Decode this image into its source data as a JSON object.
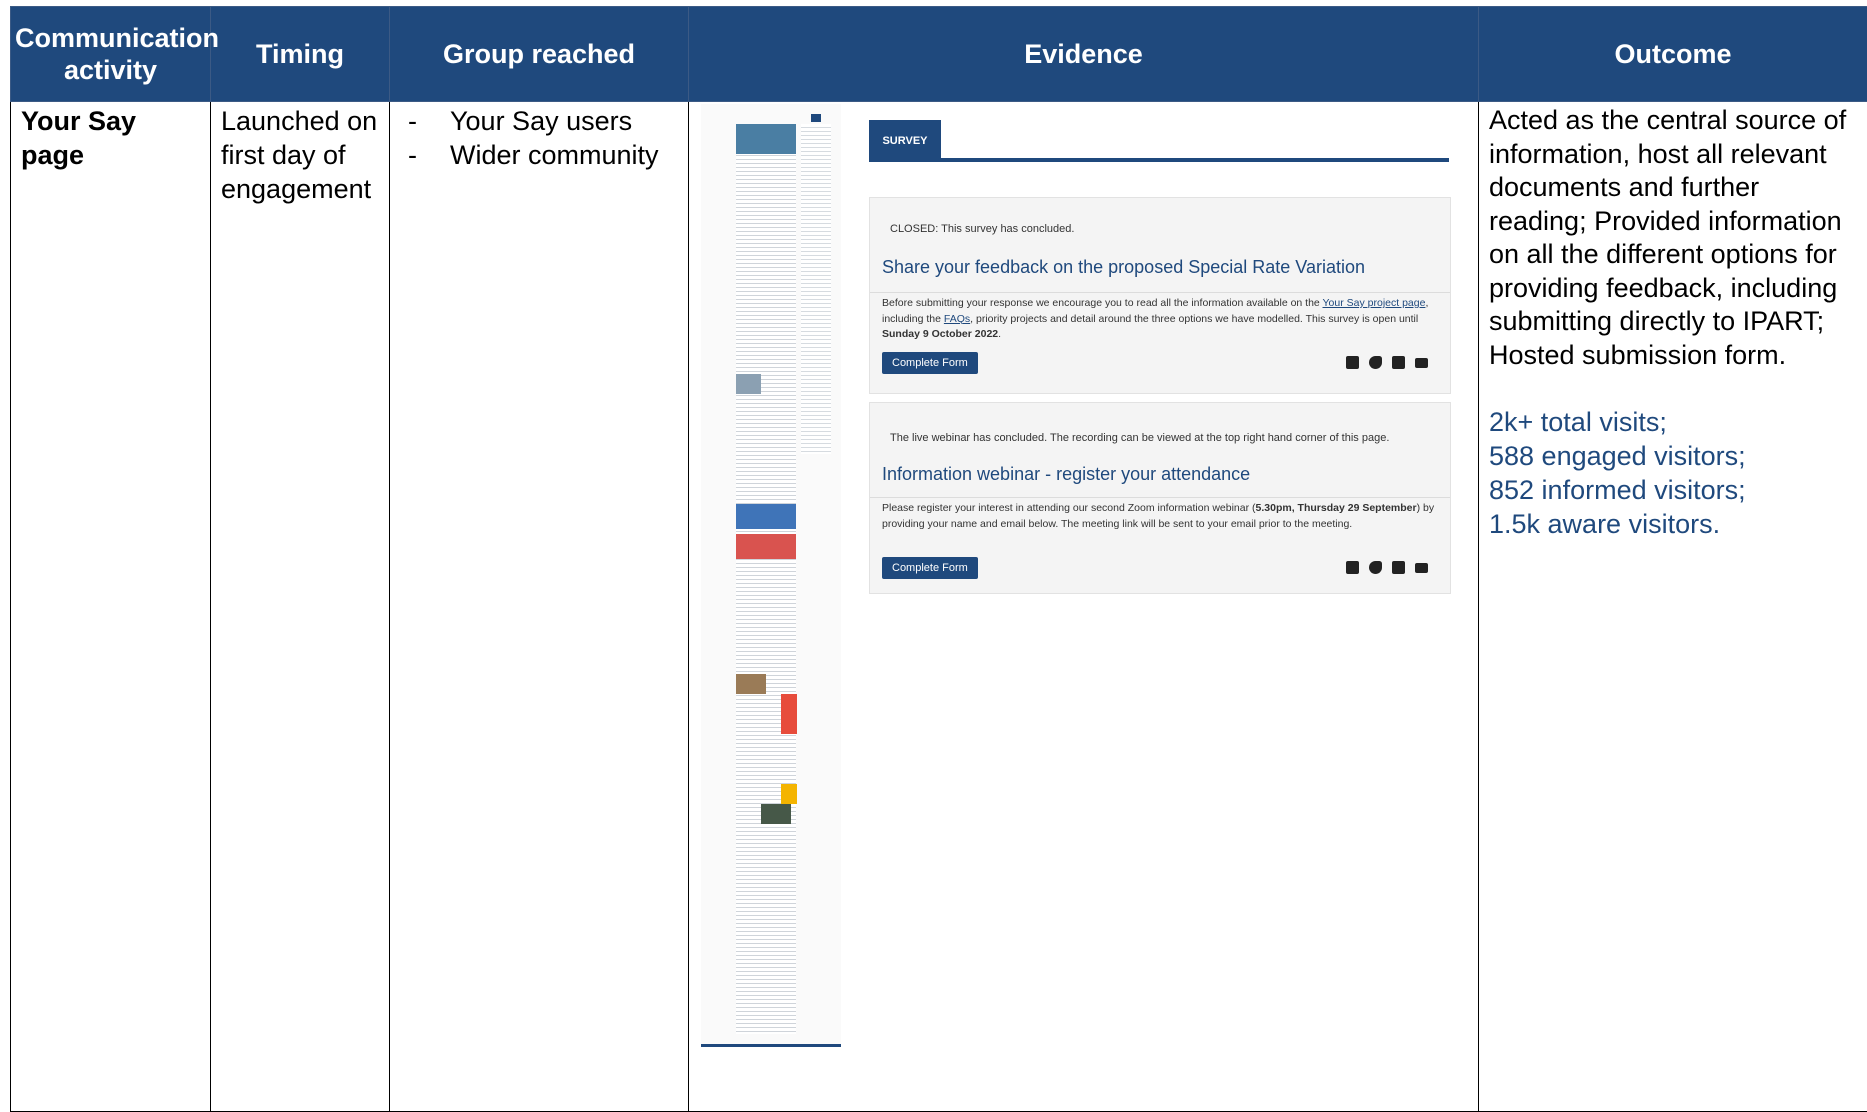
{
  "headers": {
    "activity": "Communication activity",
    "timing": "Timing",
    "group": "Group reached",
    "evidence": "Evidence",
    "outcome": "Outcome"
  },
  "row": {
    "activity": "Your Say page",
    "timing": "Launched on first day of engagement",
    "groups": [
      "Your Say users",
      "Wider community"
    ],
    "outcome": "Acted as the central source of information, host all relevant documents and further reading; Provided information on all the different options for providing feedback, including submitting directly to IPART; Hosted submission form.",
    "stats": [
      "2k+ total visits;",
      "588 engaged visitors;",
      "852 informed visitors;",
      "1.5k aware visitors."
    ]
  },
  "evidence": {
    "tab": "SURVEY",
    "survey": {
      "note": "CLOSED: This survey has concluded.",
      "title": "Share your feedback on the proposed Special Rate Variation",
      "body_1": "Before submitting your response we encourage you to read all the information available on the ",
      "link_1": "Your Say project page",
      "body_2": ", including the ",
      "link_2": "FAQs",
      "body_3": ", priority projects and detail around the three options we have modelled. This survey is open until ",
      "bold": "Sunday 9 October 2022",
      "body_4": ".",
      "button": "Complete Form"
    },
    "webinar": {
      "note": "The live webinar has concluded. The recording can be viewed at the top right hand corner of this page.",
      "title": "Information webinar - register your attendance",
      "body_1": "Please register your interest in attending our second Zoom information webinar (",
      "bold": "5.30pm, Thursday 29 September",
      "body_2": ") by providing your name and email below. The meeting link will be sent to your email prior to the meeting.",
      "button": "Complete Form"
    },
    "share_icons": [
      "facebook-icon",
      "twitter-icon",
      "linkedin-icon",
      "email-icon"
    ]
  },
  "colors": {
    "header_bg": "#1f497d",
    "stats_text": "#1f497d"
  }
}
